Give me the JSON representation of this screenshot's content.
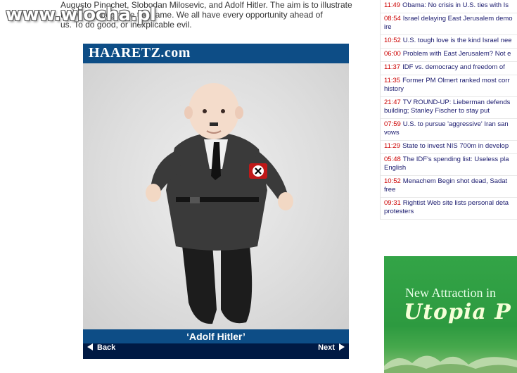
{
  "watermark": "www.wiocha.pl",
  "article": {
    "lines": [
      "Augusto Pinochet, Slobodan Milosevic, and Adolf Hitler. The aim is to illustrate",
      "that we all begin life the same. We all have every opportunity ahead of",
      "us. To do good, or inexplicable evil."
    ]
  },
  "gallery": {
    "brand": "HAARETZ.com",
    "caption": "‘Adolf Hitler’",
    "back_label": "Back",
    "next_label": "Next",
    "colors": {
      "bar": "#0d4d86",
      "nav": "#001a44"
    }
  },
  "news": [
    {
      "time": "11:49",
      "text": "Obama: No crisis in U.S. ties with Is"
    },
    {
      "time": "08:54",
      "text": "Israel delaying East Jerusalem demo ire"
    },
    {
      "time": "10:52",
      "text": "U.S. tough love is the kind Israel nee"
    },
    {
      "time": "06:00",
      "text": "Problem with East Jerusalem? Not e"
    },
    {
      "time": "11:37",
      "text": "IDF vs. democracy and freedom of"
    },
    {
      "time": "11:35",
      "text": "Former PM Olmert ranked most corr history"
    },
    {
      "time": "21:47",
      "text": "TV ROUND-UP: Lieberman defends building; Stanley Fischer to stay put"
    },
    {
      "time": "07:59",
      "text": "U.S. to pursue 'aggressive' Iran san vows"
    },
    {
      "time": "11:29",
      "text": "State to invest NIS 700m in develop"
    },
    {
      "time": "05:48",
      "text": "The IDF's spending list: Useless pla English"
    },
    {
      "time": "10:52",
      "text": "Menachem Begin shot dead, Sadat free"
    },
    {
      "time": "09:31",
      "text": "Rightist Web site lists personal deta protesters"
    }
  ],
  "ad": {
    "line1": "New Attraction in",
    "line2": "Utopia P"
  }
}
